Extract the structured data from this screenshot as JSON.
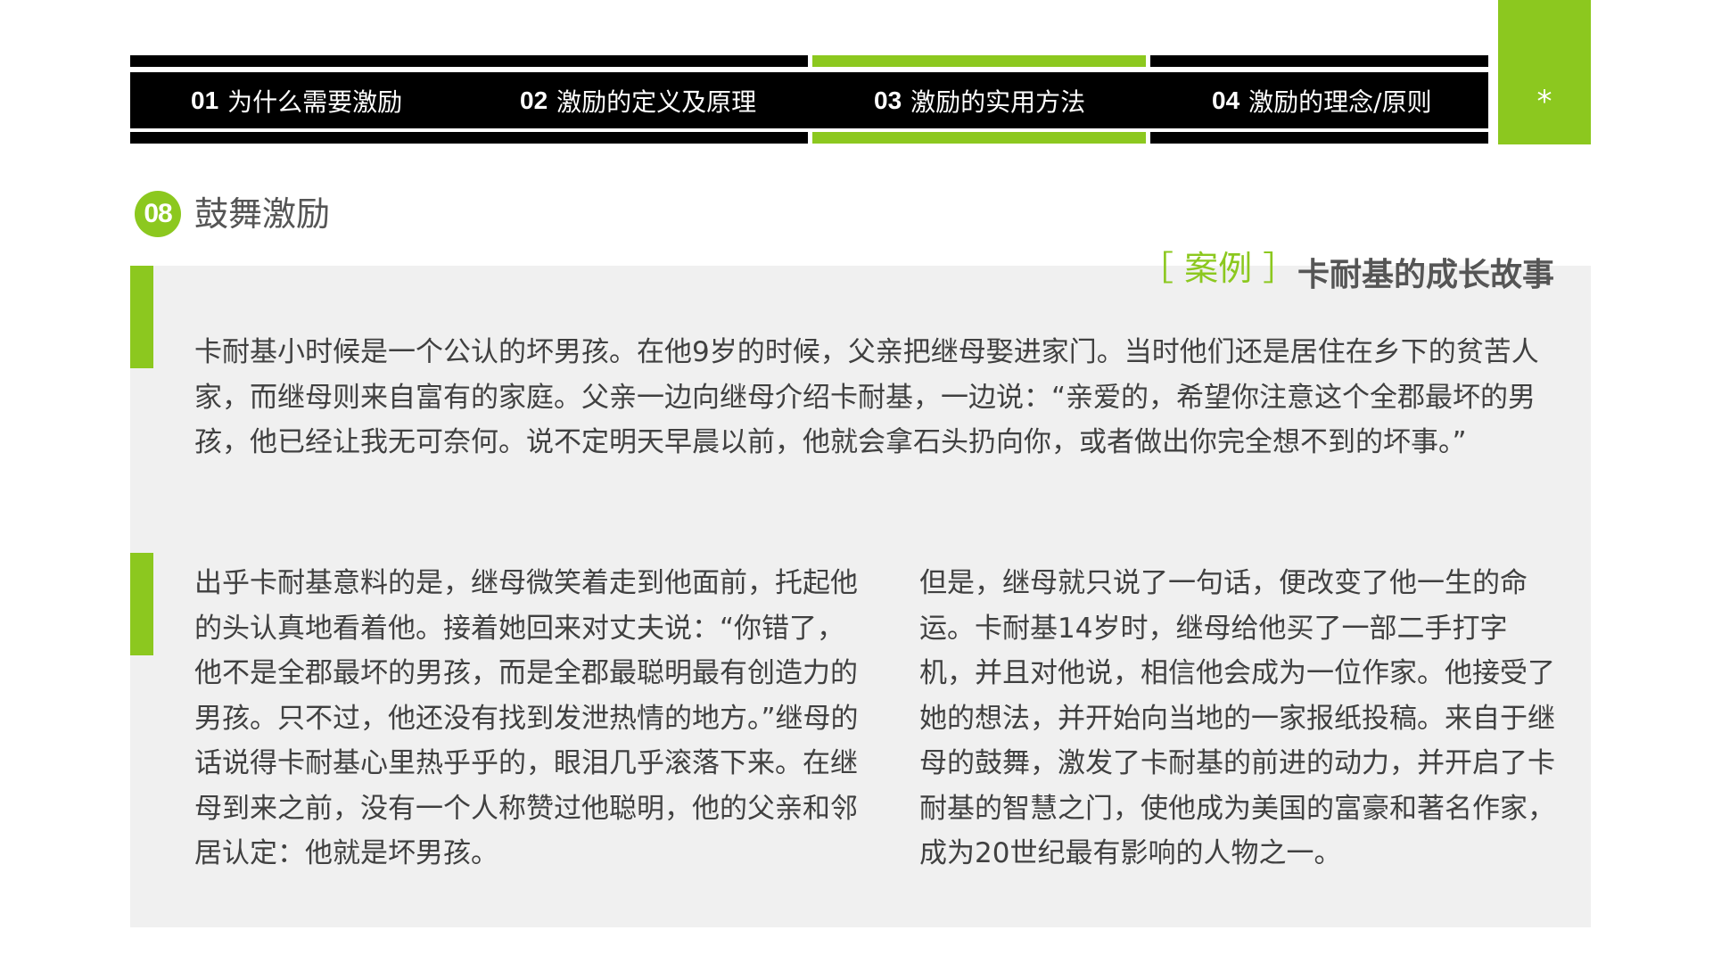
{
  "nav": {
    "items": [
      {
        "num": "01",
        "label": "为什么需要激励"
      },
      {
        "num": "02",
        "label": "激励的定义及原理"
      },
      {
        "num": "03",
        "label": "激励的实用方法"
      },
      {
        "num": "04",
        "label": "激励的理念/原则"
      }
    ],
    "active_index": 2,
    "corner_symbol": "*"
  },
  "section": {
    "number": "08",
    "title": "鼓舞激励"
  },
  "case": {
    "tag": "［ 案例 ］",
    "title": "卡耐基的成长故事"
  },
  "paragraphs": {
    "p1": "卡耐基小时候是一个公认的坏男孩。在他9岁的时候，父亲把继母娶进家门。当时他们还是居住在乡下的贫苦人家，而继母则来自富有的家庭。父亲一边向继母介绍卡耐基，一边说：“亲爱的，希望你注意这个全郡最坏的男孩，他已经让我无可奈何。说不定明天早晨以前，他就会拿石头扔向你，或者做出你完全想不到的坏事。”",
    "p2": "出乎卡耐基意料的是，继母微笑着走到他面前，托起他的头认真地看着他。接着她回来对丈夫说：“你错了，他不是全郡最坏的男孩，而是全郡最聪明最有创造力的男孩。只不过，他还没有找到发泄热情的地方。”继母的话说得卡耐基心里热乎乎的，眼泪几乎滚落下来。在继母到来之前，没有一个人称赞过他聪明，他的父亲和邻居认定：他就是坏男孩。",
    "p3": "但是，继母就只说了一句话，便改变了他一生的命运。卡耐基14岁时，继母给他买了一部二手打字机，并且对他说，相信他会成为一位作家。他接受了她的想法，并开始向当地的一家报纸投稿。来自于继母的鼓舞，激发了卡耐基的前进的动力，并开启了卡耐基的智慧之门，使他成为美国的富豪和著名作家，成为20世纪最有影响的人物之一。"
  },
  "colors": {
    "accent": "#8cc81f",
    "nav_bg": "#000000",
    "panel_bg": "#f0f0f0",
    "text": "#404040"
  }
}
